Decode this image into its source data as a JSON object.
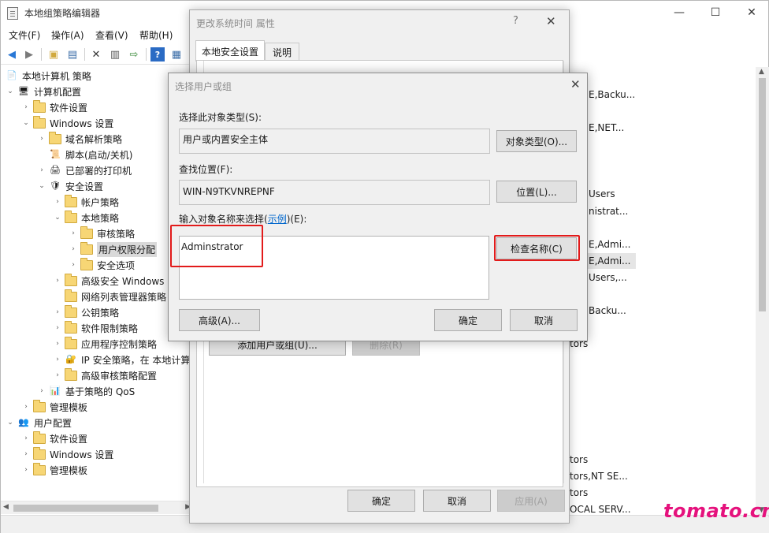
{
  "main_window": {
    "title": "本地组策略编辑器",
    "controls": {
      "minimize": "—",
      "maximize": "☐",
      "close": "✕"
    }
  },
  "menu": [
    "文件(F)",
    "操作(A)",
    "查看(V)",
    "帮助(H)"
  ],
  "toolbar_icons": [
    "back-arrow-icon",
    "forward-arrow-icon",
    "up-folder-icon",
    "show-hide-tree-icon",
    "delete-icon",
    "properties-icon",
    "export-list-icon",
    "help-icon",
    "extended-view-icon"
  ],
  "tree": [
    {
      "label": "本地计算机 策略"
    },
    {
      "label": "计算机配置"
    },
    {
      "label": "软件设置"
    },
    {
      "label": "Windows 设置"
    },
    {
      "label": "域名解析策略"
    },
    {
      "label": "脚本(启动/关机)"
    },
    {
      "label": "已部署的打印机"
    },
    {
      "label": "安全设置"
    },
    {
      "label": "帐户策略"
    },
    {
      "label": "本地策略"
    },
    {
      "label": "审核策略"
    },
    {
      "label": "用户权限分配"
    },
    {
      "label": "安全选项"
    },
    {
      "label": "高级安全 Windows"
    },
    {
      "label": "网络列表管理器策略"
    },
    {
      "label": "公钥策略"
    },
    {
      "label": "软件限制策略"
    },
    {
      "label": "应用程序控制策略"
    },
    {
      "label": "IP 安全策略，在 本地计算"
    },
    {
      "label": "高级审核策略配置"
    },
    {
      "label": "基于策略的 QoS"
    },
    {
      "label": "管理模板"
    },
    {
      "label": "用户配置"
    },
    {
      "label": "软件设置"
    },
    {
      "label": "Windows 设置"
    },
    {
      "label": "管理模板"
    }
  ],
  "right_list": [
    {
      "text": "E,Backu..."
    },
    {
      "text": "E,NET..."
    },
    {
      "text": "Users"
    },
    {
      "text": "nistrat..."
    },
    {
      "text": "E,Admi..."
    },
    {
      "text": "E,Admi..."
    },
    {
      "text": "Users,..."
    },
    {
      "text": "Backu..."
    },
    {
      "text": "tors"
    },
    {
      "text": "tors"
    },
    {
      "text": "tors,NT SE..."
    },
    {
      "text": "tors"
    },
    {
      "text": "OCAL SERV..."
    }
  ],
  "properties_dialog": {
    "title": "更改系统时间 属性",
    "help": "?",
    "close": "✕",
    "tabs": [
      "本地安全设置",
      "说明"
    ],
    "add_button": "添加用户或组(U)...",
    "remove_button": "删除(R)",
    "ok": "确定",
    "cancel": "取消",
    "apply": "应用(A)"
  },
  "select_dialog": {
    "title": "选择用户或组",
    "close": "✕",
    "object_type_label": "选择此对象类型(S):",
    "object_type_value": "用户或内置安全主体",
    "object_type_button": "对象类型(O)...",
    "location_label": "查找位置(F):",
    "location_value": "WIN-N9TKVNREPNF",
    "location_button": "位置(L)...",
    "enter_label_prefix": "输入对象名称来选择(",
    "enter_label_link": "示例",
    "enter_label_suffix": ")(E):",
    "entered_name": "Adminstrator",
    "check_names_button": "检查名称(C)",
    "advanced_button": "高级(A)...",
    "ok": "确定",
    "cancel": "取消"
  },
  "watermark": "tomato.cm",
  "colors": {
    "highlight_red": "#e21b1b",
    "watermark": "#e5127d",
    "link": "#0066cc"
  }
}
